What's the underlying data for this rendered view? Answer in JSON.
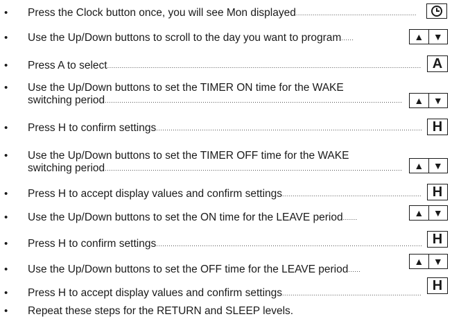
{
  "steps": [
    {
      "text": "Press the Clock button once, you will see Mon displayed",
      "button": "clock"
    },
    {
      "text": "Use the Up/Down buttons to scroll to the day you want to program",
      "button": "updown"
    },
    {
      "text": "Press A to select",
      "button": "letter",
      "letter": "A"
    },
    {
      "text": "Use the Up/Down buttons to set the TIMER ON time for the WAKE",
      "text2": "switching period",
      "button": "updown"
    },
    {
      "text": "Press H to confirm settings",
      "button": "letter",
      "letter": "H"
    },
    {
      "text": "Use the Up/Down buttons to set the TIMER OFF time for the WAKE",
      "text2": "switching period",
      "button": "updown"
    },
    {
      "text": "Press H to accept display values and confirm settings",
      "button": "letter",
      "letter": "H"
    },
    {
      "text": "Use the Up/Down buttons to set the ON time for the LEAVE period",
      "button": "updown"
    },
    {
      "text": "Press H to confirm settings",
      "button": "letter",
      "letter": "H"
    },
    {
      "text": "Use the Up/Down buttons to set the OFF time for the LEAVE period",
      "button": "updown"
    },
    {
      "text": "Press H to accept display values and confirm settings",
      "button": "letter",
      "letter": "H"
    },
    {
      "text": "Repeat these steps for the RETURN and SLEEP levels.",
      "button": "none"
    }
  ],
  "glyphs": {
    "up": "▲",
    "down": "▼",
    "clock": "clock-icon"
  }
}
